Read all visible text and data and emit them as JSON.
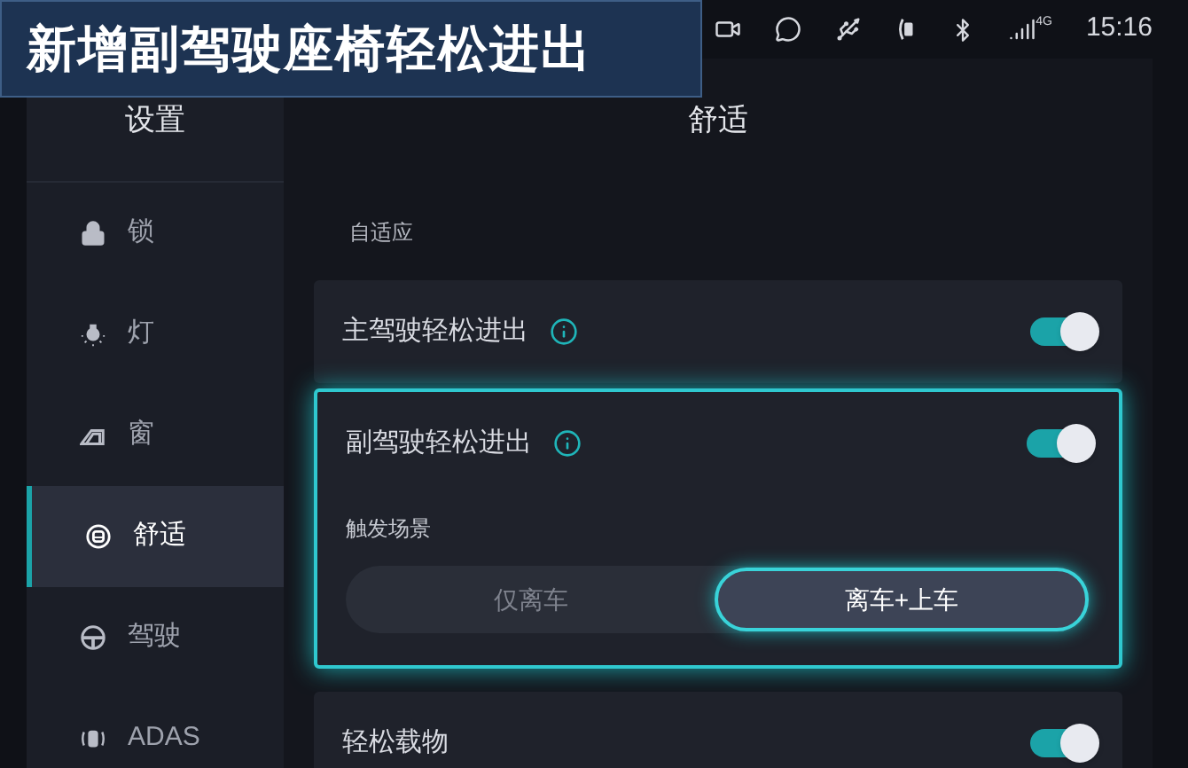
{
  "caption": "新增副驾驶座椅轻松进出",
  "status_bar": {
    "network": "4G",
    "time": "15:16"
  },
  "sidebar": {
    "title": "设置",
    "items": [
      {
        "kind": "lock",
        "label": "锁",
        "selected": false
      },
      {
        "kind": "light",
        "label": "灯",
        "selected": false
      },
      {
        "kind": "window",
        "label": "窗",
        "selected": false
      },
      {
        "kind": "comfort",
        "label": "舒适",
        "selected": true
      },
      {
        "kind": "drive",
        "label": "驾驶",
        "selected": false
      },
      {
        "kind": "adas",
        "label": "ADAS",
        "selected": false
      }
    ]
  },
  "page": {
    "title": "舒适",
    "section_label": "自适应",
    "rows": [
      {
        "label": "主驾驶轻松进出",
        "info": true,
        "on": true,
        "highlighted": false
      },
      {
        "label": "副驾驶轻松进出",
        "info": true,
        "on": true,
        "highlighted": true,
        "trigger": {
          "label": "触发场景",
          "options": [
            {
              "label": "仅离车",
              "selected": false
            },
            {
              "label": "离车+上车",
              "selected": true
            }
          ]
        }
      },
      {
        "label": "轻松载物",
        "info": false,
        "on": true,
        "highlighted": false
      }
    ]
  }
}
